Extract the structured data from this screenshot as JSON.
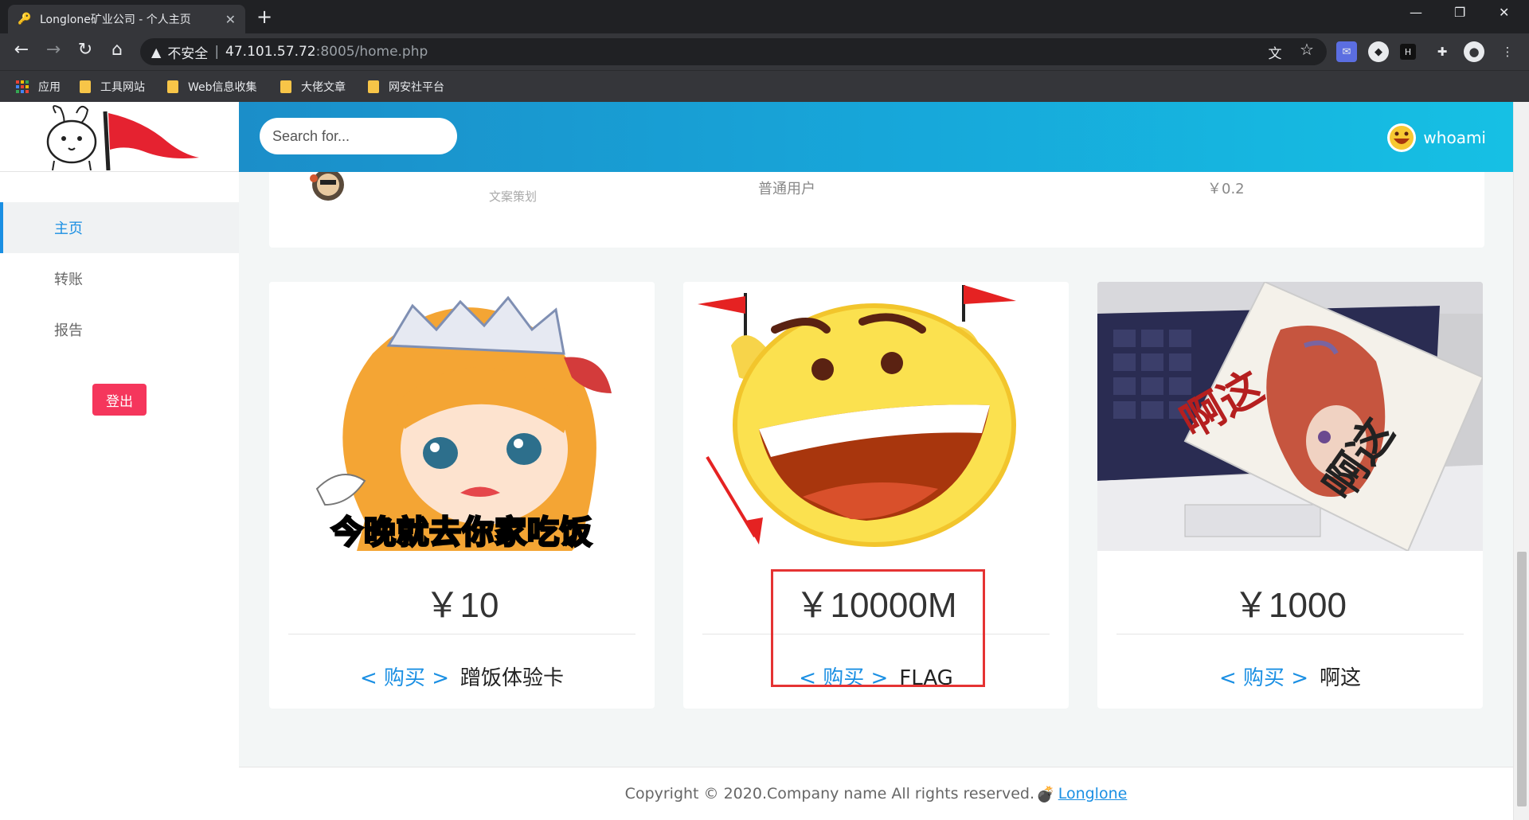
{
  "browser": {
    "tab_title": "Longlone矿业公司 - 个人主页",
    "url_warning": "不安全",
    "url_host": "47.101.57.72",
    "url_path": ":8005/home.php",
    "bookmarks": [
      "应用",
      "工具网站",
      "Web信息收集",
      "大佬文章",
      "网安社平台"
    ]
  },
  "header": {
    "search_placeholder": "Search for...",
    "username": "whoami"
  },
  "sidebar": {
    "items": [
      {
        "label": "主页",
        "active": true
      },
      {
        "label": "转账",
        "active": false
      },
      {
        "label": "报告",
        "active": false
      }
    ],
    "logout_label": "登出"
  },
  "user_row": {
    "role_sub": "文案策划",
    "type": "普通用户",
    "balance": "￥0.2"
  },
  "products": [
    {
      "price": "￥10",
      "buy_label": "< 购买 >",
      "name": "蹭饭体验卡",
      "caption": "今晚就去你家吃饭"
    },
    {
      "price": "￥10000M",
      "buy_label": "< 购买 >",
      "name": "FLAG"
    },
    {
      "price": "￥1000",
      "buy_label": "< 购买 >",
      "name": "啊这",
      "caption": "啊这"
    }
  ],
  "footer": {
    "text": "Copyright © 2020.Company name All rights reserved.",
    "brand": "Longlone"
  },
  "colors": {
    "accent": "#1a8fe3",
    "logout": "#f5365c",
    "highlight": "#e53333"
  }
}
